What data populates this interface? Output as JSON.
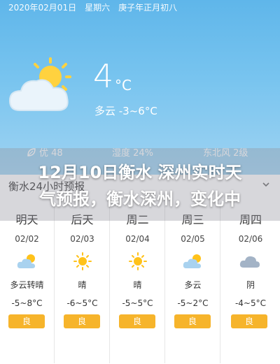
{
  "hero": {
    "date": "2020年02月01日　星期六　庚子年正月初八",
    "temperature": "4",
    "unit": "°C",
    "condition": "多云 -3~6°C",
    "aqi": "优 48",
    "humidity": "湿度 24%",
    "wind": "东北风 2级",
    "colors": {
      "top": "#5fb6ea",
      "bottom": "#9fd3f2"
    }
  },
  "forecast": {
    "header": "衡水24小时预报",
    "days": [
      {
        "name": "明天",
        "date": "02/02",
        "icon": "partly-cloudy-icon",
        "condition": "多云转晴",
        "range": "-5~8°C",
        "aqi": "良"
      },
      {
        "name": "后天",
        "date": "02/03",
        "icon": "sun-icon",
        "condition": "晴",
        "range": "-6~5°C",
        "aqi": "良"
      },
      {
        "name": "周二",
        "date": "02/04",
        "icon": "sun-icon",
        "condition": "晴",
        "range": "-5~5°C",
        "aqi": "良"
      },
      {
        "name": "周三",
        "date": "02/05",
        "icon": "partly-cloudy-icon",
        "condition": "多云",
        "range": "-5~2°C",
        "aqi": "良"
      },
      {
        "name": "周四",
        "date": "02/06",
        "icon": "cloud-icon",
        "condition": "阴",
        "range": "-4~5°C",
        "aqi": "良"
      }
    ],
    "aqi_color": "#f6b42b"
  },
  "headline": {
    "line1": "12月10日衡水 深州实时天",
    "line2": "气预报，衡水深州，变化中"
  }
}
